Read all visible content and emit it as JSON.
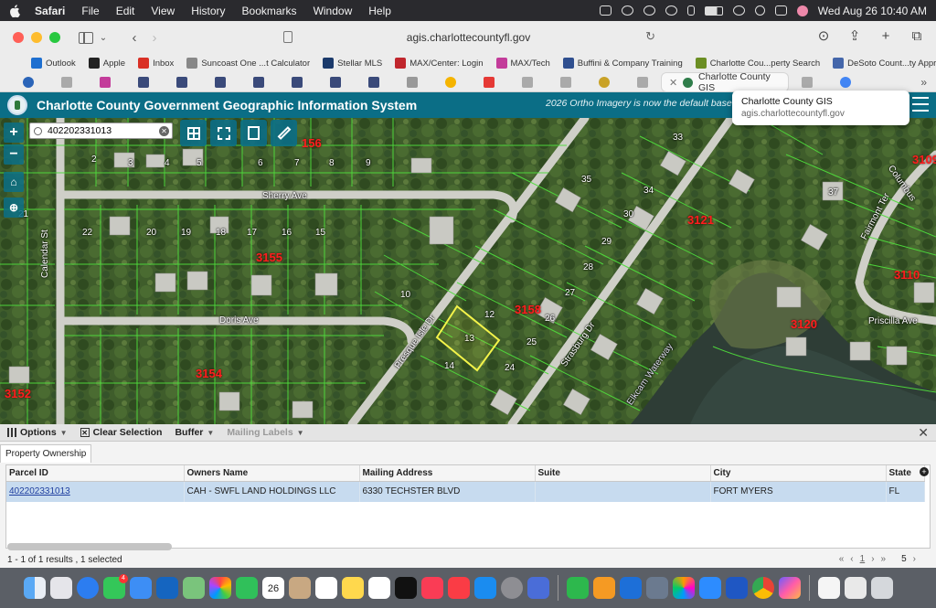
{
  "menubar": {
    "app": "Safari",
    "items": [
      "File",
      "Edit",
      "View",
      "History",
      "Bookmarks",
      "Window",
      "Help"
    ],
    "clock": "Wed Aug 26  10:40 AM"
  },
  "safari": {
    "url": "agis.charlottecountyfl.gov",
    "bookmarks": [
      {
        "label": "Outlook",
        "color": "#1e6fd0"
      },
      {
        "label": "Apple",
        "color": "#222222"
      },
      {
        "label": "Inbox",
        "color": "#d93025"
      },
      {
        "label": "Suncoast One ...t Calculator",
        "color": "#888888"
      },
      {
        "label": "Stellar MLS",
        "color": "#1b3a6b"
      },
      {
        "label": "MAX/Center: Login",
        "color": "#c0262d"
      },
      {
        "label": "MAX/Tech",
        "color": "#c33c9a"
      },
      {
        "label": "Buffini & Company Training",
        "color": "#2f4f8f"
      },
      {
        "label": "Charlotte Cou...perty Search",
        "color": "#6b8e23"
      },
      {
        "label": "DeSoto Count...ty Appraiser",
        "color": "#4466aa"
      }
    ],
    "active_tab": "Charlotte County GIS"
  },
  "tooltip": {
    "title": "Charlotte County GIS",
    "subtitle": "agis.charlottecountyfl.gov"
  },
  "gis": {
    "title": "Charlotte County Government Geographic Information System",
    "banner": "2026 Ortho Imagery is now the default basema",
    "search_value": "402202331013",
    "map_labels": {
      "streets": [
        "Sherry Ave",
        "Doris Ave",
        "Calendar St",
        "Presque Isle Dr",
        "Strasburg Dr",
        "Elkcam Waterway",
        "Priscilla Ave",
        "Columbus",
        "Fairmont Ter"
      ],
      "blocks": [
        "156",
        "3155",
        "3154",
        "3158",
        "3152",
        "3121",
        "3110",
        "3120",
        "3109"
      ],
      "lots": [
        "14",
        "13",
        "12",
        "2",
        "3",
        "4",
        "5",
        "6",
        "7",
        "8",
        "9",
        "10",
        "15",
        "16",
        "17",
        "18",
        "19",
        "20",
        "21",
        "22",
        "24",
        "25",
        "26",
        "27",
        "28",
        "29",
        "30",
        "33",
        "34",
        "35",
        "37"
      ]
    }
  },
  "panel": {
    "menu": {
      "options": "Options",
      "clear": "Clear Selection",
      "buffer": "Buffer",
      "mailing": "Mailing Labels"
    },
    "tab": "Property Ownership",
    "columns": [
      "Parcel ID",
      "Owners Name",
      "Mailing Address",
      "Suite",
      "City",
      "State"
    ],
    "rows": [
      {
        "parcel_id": "402202331013",
        "owner": "CAH - SWFL LAND HOLDINGS LLC",
        "address": "6330 TECHSTER BLVD",
        "suite": "",
        "city": "FORT MYERS",
        "state": "FL"
      }
    ],
    "status": "1 - 1 of 1 results , 1 selected",
    "page": "1",
    "page_size": "5"
  },
  "dock": {
    "calendar_day": "26",
    "badge": "4"
  }
}
